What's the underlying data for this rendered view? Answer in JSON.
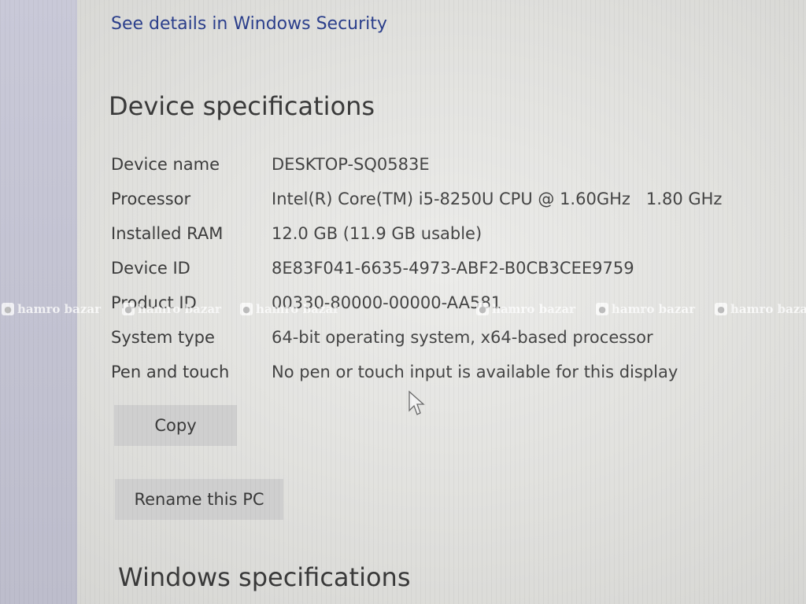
{
  "security_link": "See details in Windows Security",
  "device_specs": {
    "title": "Device specifications",
    "rows": [
      {
        "label": "Device name",
        "value": "DESKTOP-SQ0583E"
      },
      {
        "label": "Processor",
        "value": "Intel(R) Core(TM) i5-8250U CPU @ 1.60GHz   1.80 GHz"
      },
      {
        "label": "Installed RAM",
        "value": "12.0 GB (11.9 GB usable)"
      },
      {
        "label": "Device ID",
        "value": "8E83F041-6635-4973-ABF2-B0CB3CEE9759"
      },
      {
        "label": "Product ID",
        "value": "00330-80000-00000-AA581"
      },
      {
        "label": "System type",
        "value": "64-bit operating system, x64-based processor"
      },
      {
        "label": "Pen and touch",
        "value": "No pen or touch input is available for this display"
      }
    ],
    "copy_button": "Copy",
    "rename_button": "Rename this PC"
  },
  "windows_specs": {
    "title": "Windows specifications"
  },
  "watermark": {
    "text": "hamro bazar"
  },
  "icons": {
    "cursor": "mouse-pointer-icon",
    "watermark_logo": "hamrobazar-logo-icon"
  }
}
